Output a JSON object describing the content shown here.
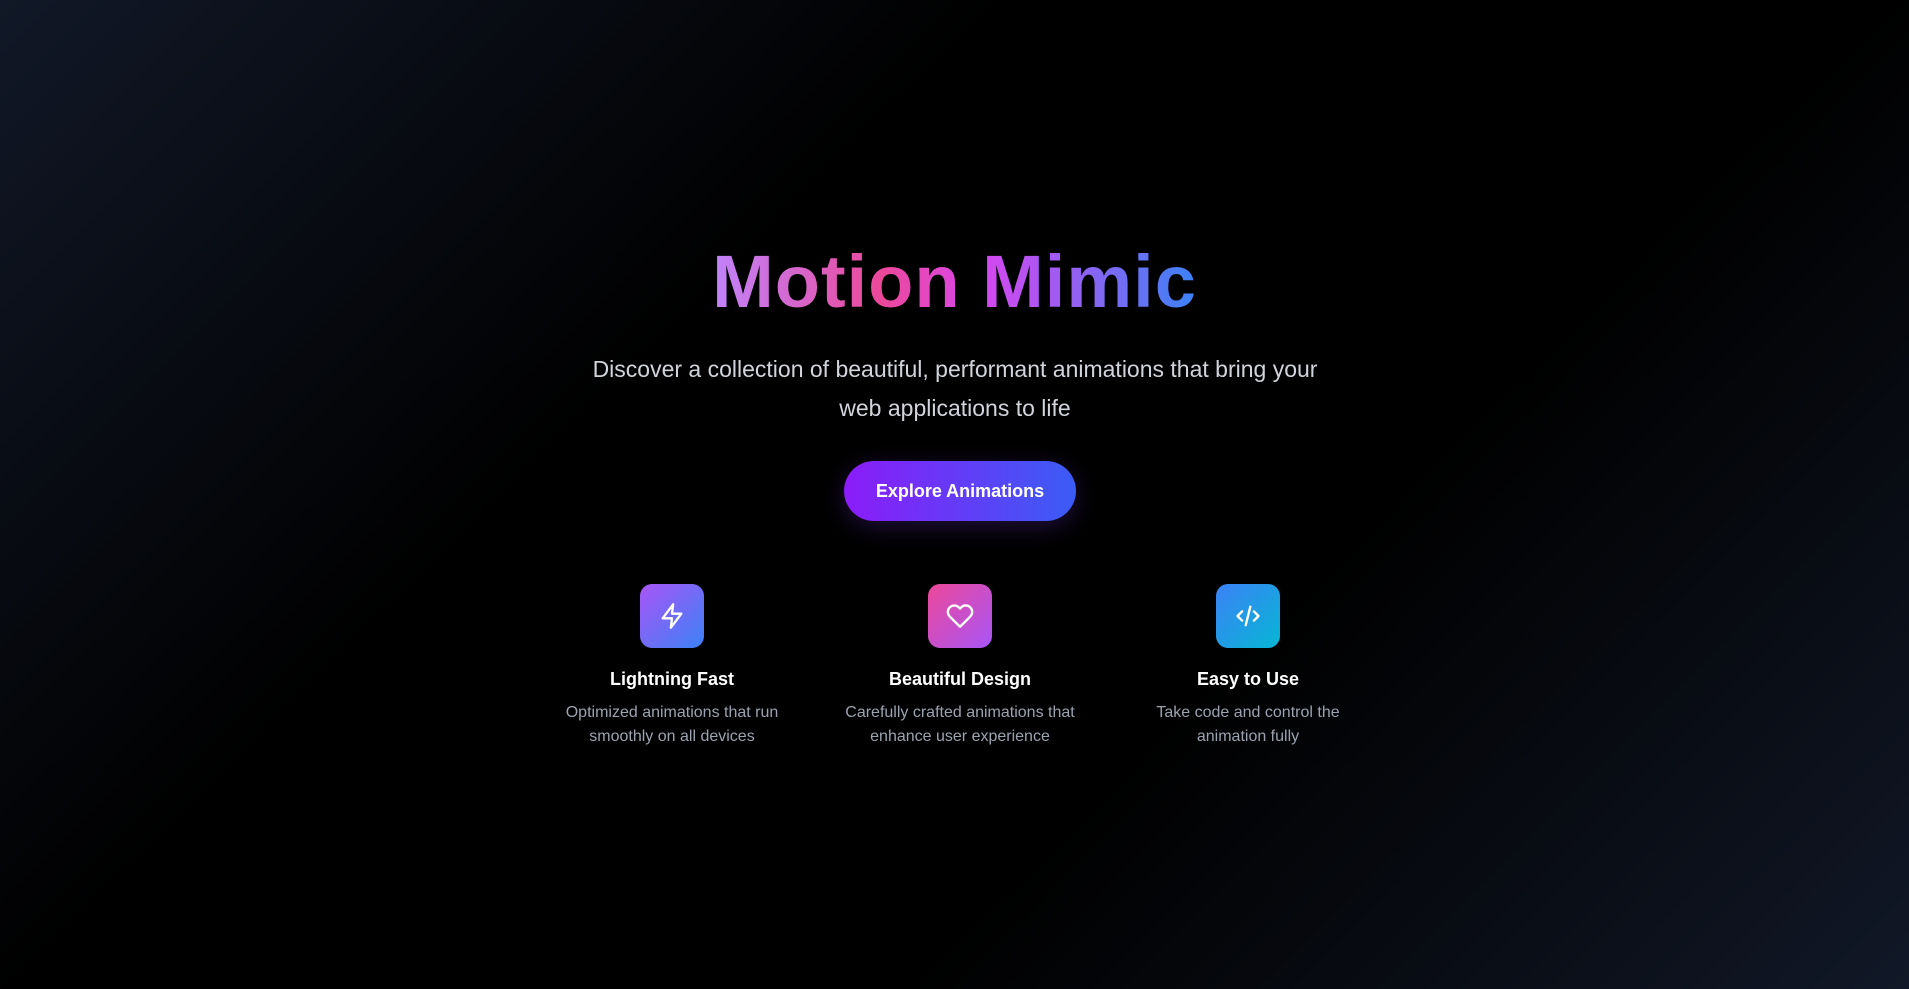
{
  "hero": {
    "title": "Motion Mimic",
    "subtitle": "Discover a collection of beautiful, performant animations that bring your web applications to life",
    "cta_label": "Explore Animations"
  },
  "features": [
    {
      "icon": "lightning-icon",
      "title": "Lightning Fast",
      "description": "Optimized animations that run smoothly on all devices"
    },
    {
      "icon": "heart-icon",
      "title": "Beautiful Design",
      "description": "Carefully crafted animations that enhance user experience"
    },
    {
      "icon": "code-icon",
      "title": "Easy to Use",
      "description": "Take code and control the animation fully"
    }
  ],
  "colors": {
    "background": "#000000",
    "title_gradient": [
      "#c084fc",
      "#ec4899",
      "#d946ef",
      "#3b82f6"
    ],
    "cta_gradient": [
      "#8b1cf8",
      "#3b5cf6"
    ],
    "feature1_gradient": [
      "#a855f7",
      "#3b82f6"
    ],
    "feature2_gradient": [
      "#ec4899",
      "#a855f7"
    ],
    "feature3_gradient": [
      "#3b82f6",
      "#06b6d4"
    ],
    "subtitle_text": "#d1d5db",
    "description_text": "#9ca3af"
  }
}
